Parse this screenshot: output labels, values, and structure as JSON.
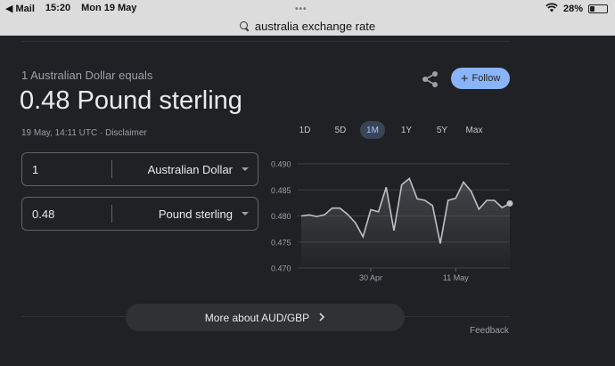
{
  "status_bar": {
    "back_app": "◀ Mail",
    "time": "15:20",
    "date": "Mon 19 May",
    "battery": "28%",
    "battery_level": 0.28
  },
  "url_bar": {
    "query": "australia exchange rate"
  },
  "converter": {
    "subtitle": "1 Australian Dollar equals",
    "value": "0.48 Pound sterling",
    "timestamp": "19 May, 14:11 UTC · Disclaimer",
    "follow_label": "Follow",
    "from": {
      "amount": "1",
      "currency": "Australian Dollar"
    },
    "to": {
      "amount": "0.48",
      "currency": "Pound sterling"
    },
    "ranges": [
      "1D",
      "5D",
      "1M",
      "1Y",
      "5Y",
      "Max"
    ],
    "active_range": "1M",
    "more_label": "More about AUD/GBP",
    "feedback": "Feedback"
  },
  "colors": {
    "background": "#202124",
    "accent": "#8ab4f8",
    "line": "#bdc1c6"
  },
  "chart_data": {
    "type": "line",
    "y_ticks": [
      "0.490",
      "0.485",
      "0.480",
      "0.475",
      "0.470"
    ],
    "ylim": [
      0.47,
      0.49
    ],
    "x_ticks": [
      {
        "label": "30 Apr",
        "index": 9
      },
      {
        "label": "11 May",
        "index": 20
      }
    ],
    "values": [
      0.48,
      0.4802,
      0.4799,
      0.4802,
      0.4815,
      0.4815,
      0.4803,
      0.4787,
      0.476,
      0.4812,
      0.4808,
      0.4855,
      0.4772,
      0.486,
      0.4872,
      0.4833,
      0.483,
      0.482,
      0.4747,
      0.483,
      0.4834,
      0.4865,
      0.4847,
      0.4813,
      0.483,
      0.483,
      0.4816,
      0.4824
    ],
    "grid": true
  }
}
